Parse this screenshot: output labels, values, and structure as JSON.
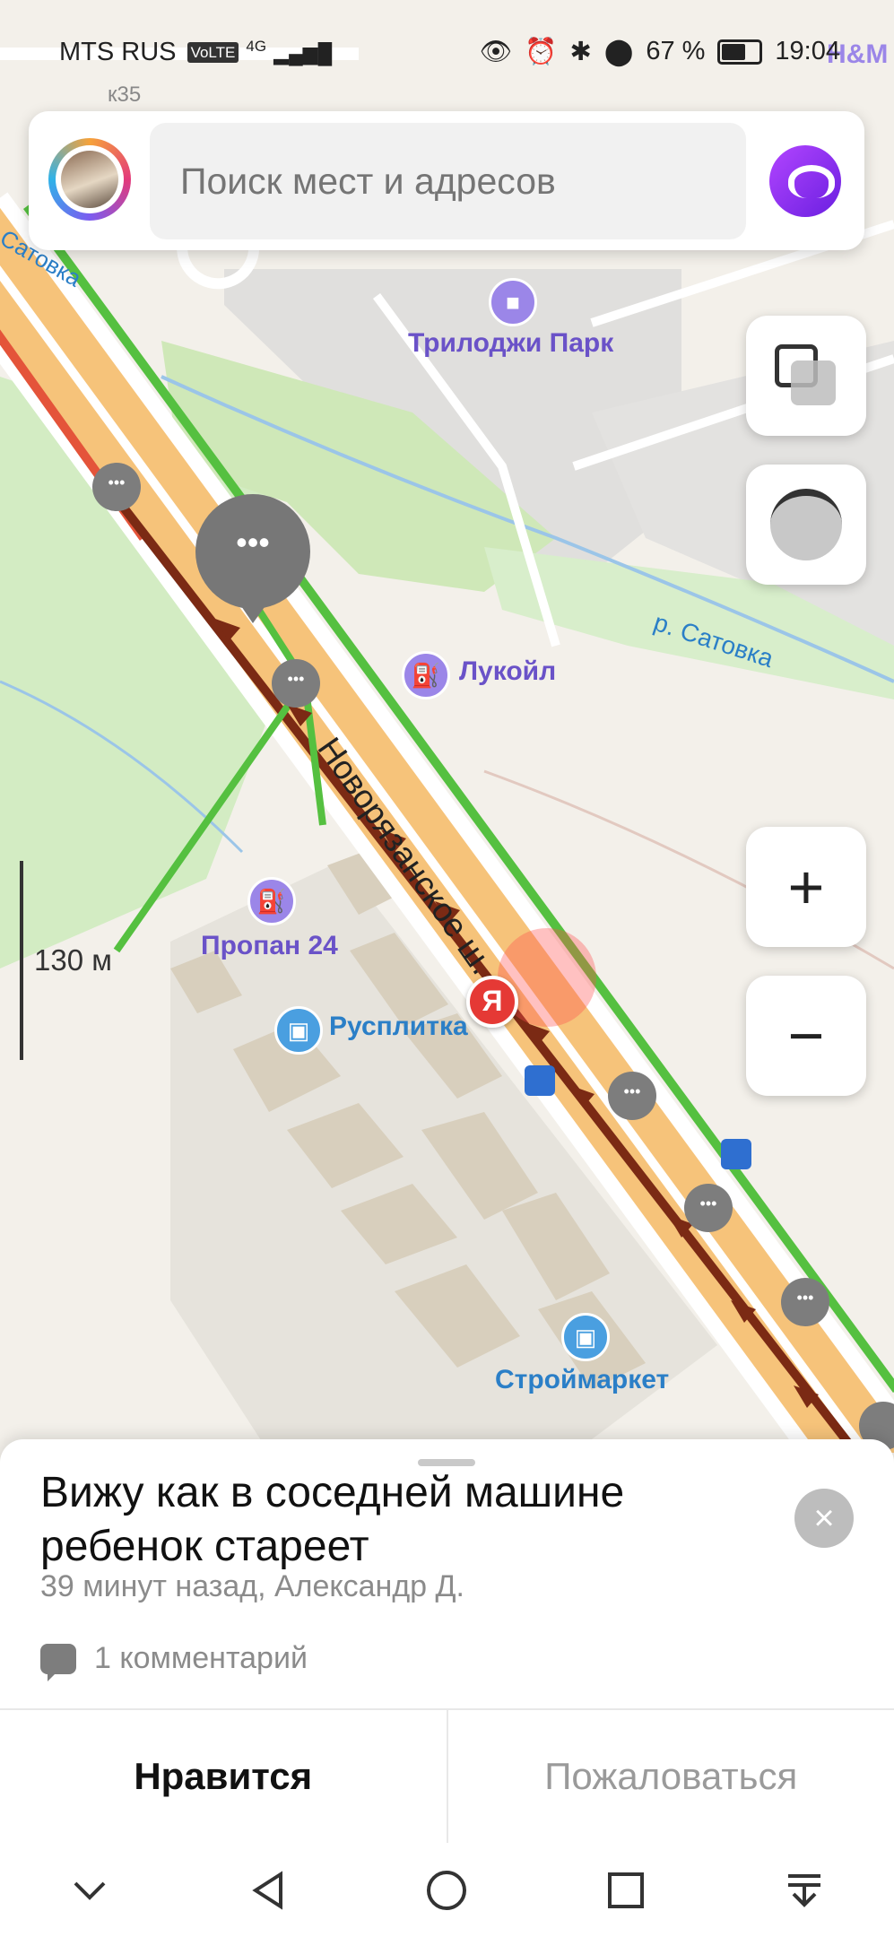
{
  "status_bar": {
    "carrier": "MTS RUS",
    "volte": "VoLTE",
    "network": "4G",
    "battery": "67 %",
    "time": "19:04"
  },
  "search": {
    "placeholder": "Поиск мест и адресов"
  },
  "map": {
    "labels": {
      "building_k35": "к35",
      "hm": "H&M",
      "satovka_top": "Сатовка",
      "trilogy": "Трилоджи Парк",
      "river": "р. Сатовка",
      "lukoil": "Лукойл",
      "road": "Новорязанское ш.",
      "propan": "Пропан 24",
      "rusplitka": "Русплитка",
      "stroymarket": "Строймаркет"
    },
    "scale_label": "130 м",
    "pin_letter": "Я"
  },
  "controls": {
    "zoom_in": "+",
    "zoom_out": "−"
  },
  "sheet": {
    "title": "Вижу как в соседней машине ребенок стареет",
    "meta": "39 минут назад, Александр Д.",
    "comments": "1 комментарий",
    "like_label": "Нравится",
    "report_label": "Пожаловаться",
    "close": "×"
  }
}
